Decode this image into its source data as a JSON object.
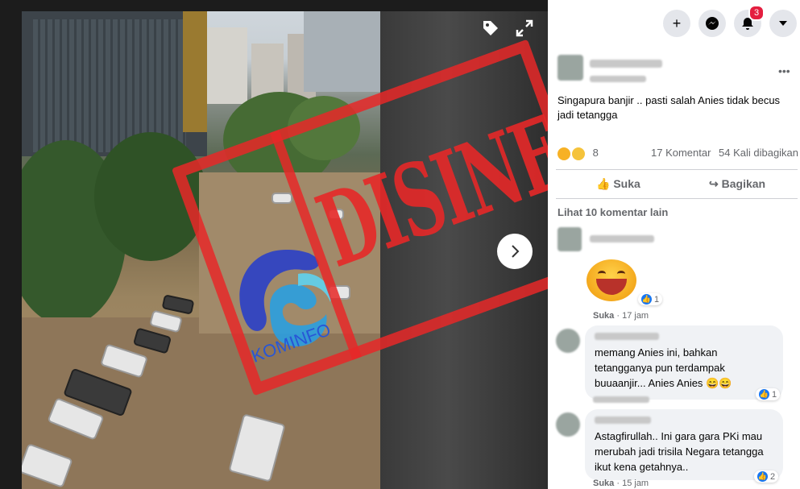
{
  "photo_viewer": {
    "stamp_text": "DISINFORMASI",
    "watermark_logo_text": "KOMINFO",
    "next_icon": "chevron-right-icon",
    "tag_icon": "tag-icon",
    "expand_icon": "expand-icon"
  },
  "topbar": {
    "buttons": [
      "plus-icon",
      "messenger-icon",
      "bell-icon",
      "caret-down-icon"
    ],
    "notification_count": "3"
  },
  "post": {
    "options": "•••",
    "text": "Singapura banjir .. pasti salah Anies tidak becus jadi tetangga",
    "reaction_count": "8",
    "comments": "17 Komentar",
    "shares": "54 Kali dibagikan",
    "like_label": "Suka",
    "share_label": "Bagikan",
    "more_comments": "Lihat 10 komentar lain"
  },
  "comments": [
    {
      "sticker": "laughing-face-sticker",
      "likes": "1",
      "action": "Suka",
      "time": "· 17 jam"
    },
    {
      "text": "memang Anies ini, bahkan tetangganya pun terdampak buuaanjir... Anies Anies 😄😄",
      "likes": "1"
    },
    {
      "text": "Astagfirullah.. Ini gara gara PKi mau merubah jadi trisila Negara tetangga ikut kena getahnya..",
      "likes": "2",
      "action": "Suka",
      "time": "· 15 jam"
    }
  ],
  "colors": {
    "stamp_red": "#e62828",
    "kominfo_blue": "#2856d6",
    "like_blue": "#1877f2",
    "badge_red": "#e41e3f"
  }
}
